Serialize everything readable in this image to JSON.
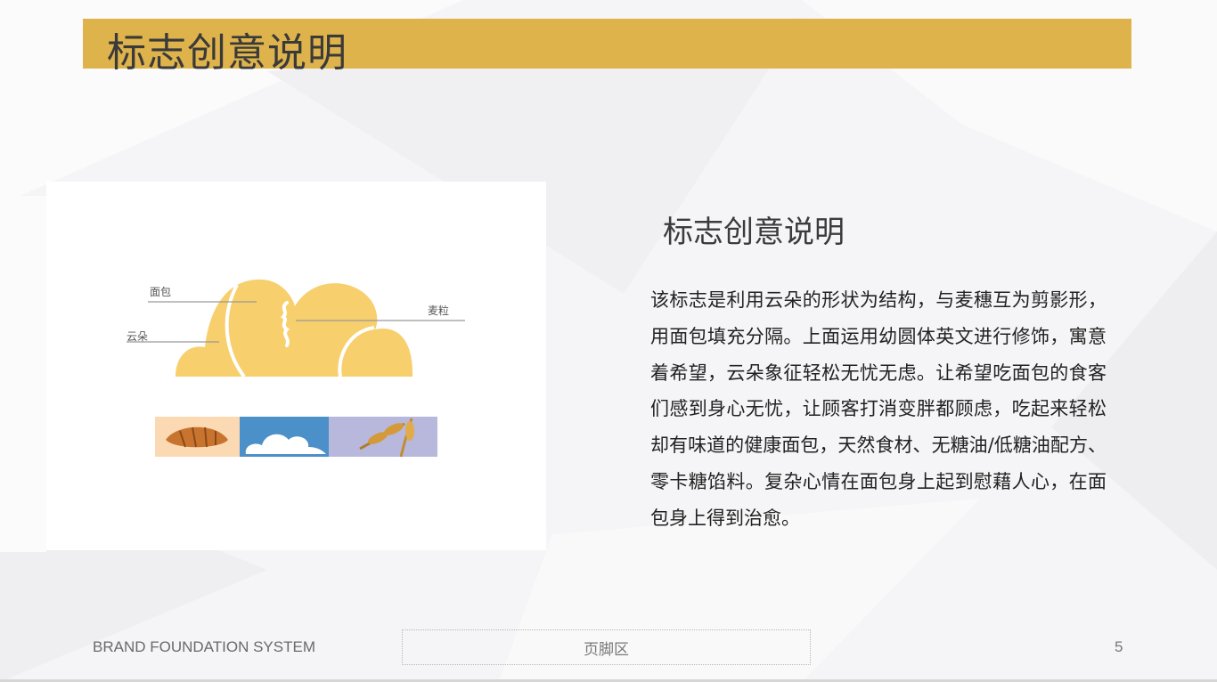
{
  "slide": {
    "title": "标志创意说明",
    "accent_color": "#deb34b"
  },
  "logo_figure": {
    "labels": {
      "bread": "面包",
      "cloud": "云朵",
      "wheat": "麦粒"
    },
    "logo_color": "#f7cf6d",
    "tiles": [
      "croissant-photo",
      "cloud-photo",
      "wheat-photo"
    ]
  },
  "content": {
    "heading": "标志创意说明",
    "body": "该标志是利用云朵的形状为结构，与麦穗互为剪影形，用面包填充分隔。上面运用幼圆体英文进行修饰，寓意着希望，云朵象征轻松无忧无虑。让希望吃面包的食客们感到身心无忧，让顾客打消变胖都顾虑，吃起来轻松却有味道的健康面包，天然食材、无糖油/低糖油配方、零卡糖馅料。复杂心情在面包身上起到慰藉人心，在面包身上得到治愈。"
  },
  "footer": {
    "brand": "BRAND FOUNDATION SYSTEM",
    "placeholder": "页脚区",
    "page_number": "5"
  }
}
